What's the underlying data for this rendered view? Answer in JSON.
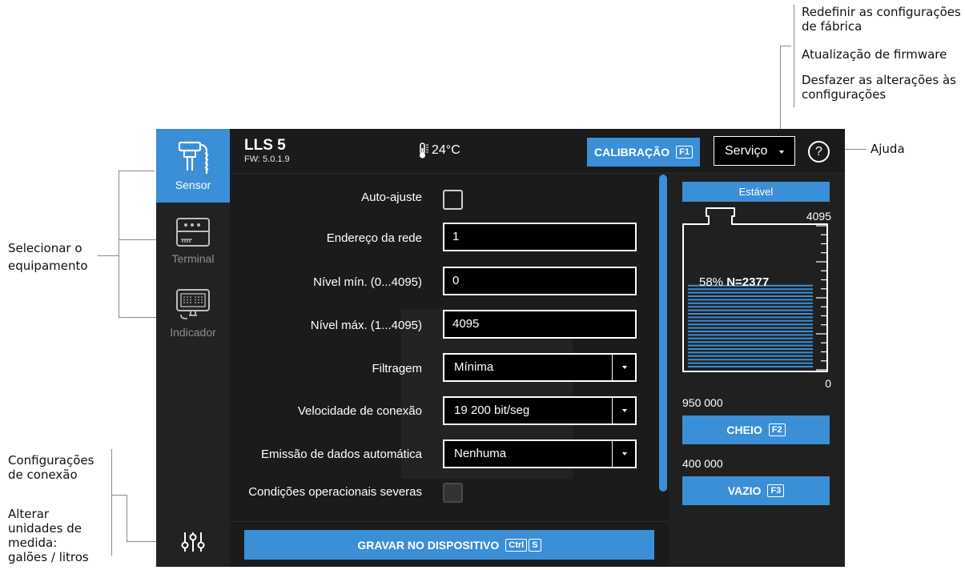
{
  "annotations": {
    "factory_reset": [
      "Redefinir as configurações",
      "de fábrica"
    ],
    "firmware_update": "Atualização de firmware",
    "undo_changes": [
      "Desfazer as alterações às",
      "configurações"
    ],
    "help": "Ajuda",
    "select_equipment": [
      "Selecionar o",
      "equipamento"
    ],
    "connection_settings": [
      "Configurações",
      "de conexão"
    ],
    "change_units": [
      "Alterar",
      "unidades de",
      "medida:",
      "galões / litros"
    ]
  },
  "sidebar": {
    "items": [
      {
        "label": "Sensor",
        "active": true
      },
      {
        "label": "Terminal",
        "active": false
      },
      {
        "label": "Indicador",
        "active": false
      }
    ]
  },
  "header": {
    "device_name": "LLS 5",
    "firmware": "FW: 5.0.1.9",
    "temperature": "24°C",
    "calibration_label": "CALIBRAÇÃO",
    "calibration_key": "F1",
    "service_label": "Serviço",
    "help_label": "?"
  },
  "form": {
    "auto_adjust_label": "Auto-ajuste",
    "auto_adjust_checked": false,
    "network_address_label": "Endereço da rede",
    "network_address_value": "1",
    "min_level_label": "Nível mín. (0...4095)",
    "min_level_value": "0",
    "max_level_label": "Nível máx. (1...4095)",
    "max_level_value": "4095",
    "filter_label": "Filtragem",
    "filter_value": "Mínima",
    "speed_label": "Velocidade de conexão",
    "speed_value": "19 200 bit/seg",
    "auto_output_label": "Emissão de dados automática",
    "auto_output_value": "Nenhuma",
    "severe_conditions_label": "Condições operacionais severas",
    "severe_conditions_checked": false
  },
  "footer": {
    "save_label": "GRAVAR NO DISPOSITIVO",
    "save_key_1": "Ctrl",
    "save_key_2": "S"
  },
  "tank": {
    "status": "Estável",
    "max": "4095",
    "min": "0",
    "percent": "58%",
    "level_text": "N=2377",
    "fill_fraction": 0.58,
    "full_value": "950 000",
    "full_label": "CHEIO",
    "full_key": "F2",
    "empty_value": "400 000",
    "empty_label": "VAZIO",
    "empty_key": "F3"
  },
  "colors": {
    "accent": "#3a8fd6",
    "background": "#1b1b1b",
    "sidebar": "#222222"
  }
}
